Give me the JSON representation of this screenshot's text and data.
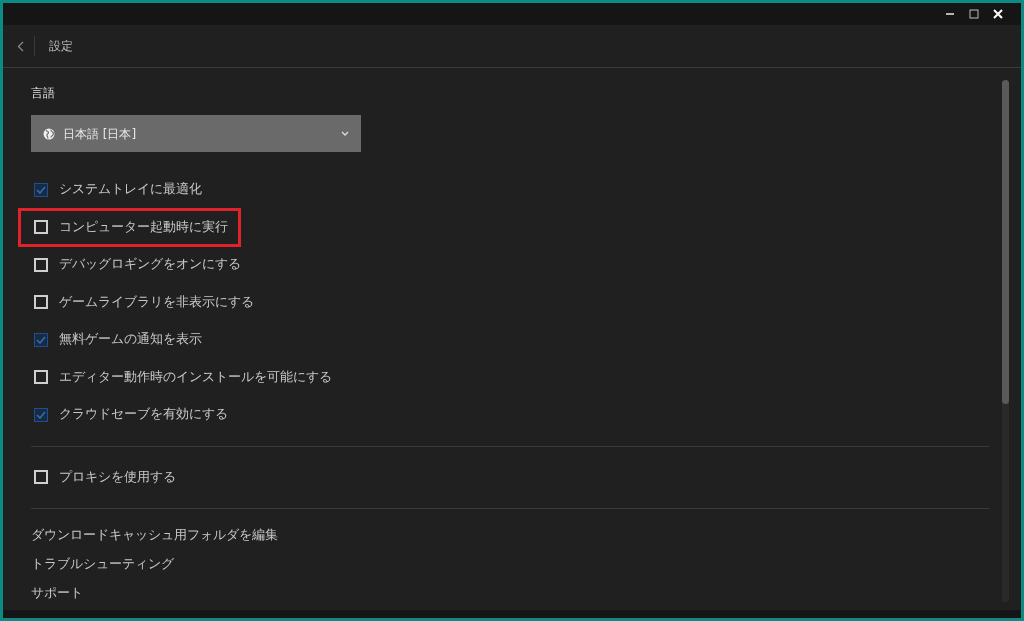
{
  "header": {
    "title": "設定"
  },
  "language": {
    "label": "言語",
    "value": "日本語 [日本]"
  },
  "options": [
    {
      "label": "システムトレイに最適化",
      "checked": true,
      "highlighted": false
    },
    {
      "label": "コンピューター起動時に実行",
      "checked": false,
      "highlighted": true
    },
    {
      "label": "デバッグロギングをオンにする",
      "checked": false,
      "highlighted": false
    },
    {
      "label": "ゲームライブラリを非表示にする",
      "checked": false,
      "highlighted": false
    },
    {
      "label": "無料ゲームの通知を表示",
      "checked": true,
      "highlighted": false
    },
    {
      "label": "エディター動作時のインストールを可能にする",
      "checked": false,
      "highlighted": false
    },
    {
      "label": "クラウドセーブを有効にする",
      "checked": true,
      "highlighted": false
    }
  ],
  "proxy": {
    "label": "プロキシを使用する",
    "checked": false
  },
  "links": [
    "ダウンロードキャッシュ用フォルダを編集",
    "トラブルシューティング",
    "サポート"
  ]
}
